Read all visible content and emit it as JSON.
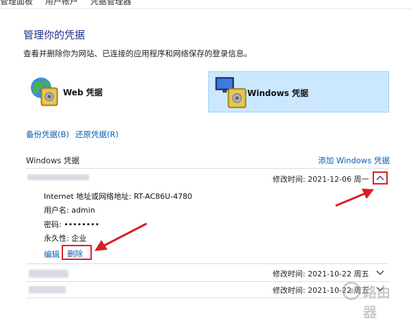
{
  "breadcrumb": {
    "items": [
      "管理面板",
      "用户帐户",
      "凭据管理器"
    ]
  },
  "page": {
    "title": "管理你的凭据",
    "subtitle": "查看并删除你为网站、已连接的应用程序和网络保存的登录信息。"
  },
  "tiles": {
    "web": {
      "label": "Web 凭据"
    },
    "windows": {
      "label": "Windows 凭据",
      "selected": true
    }
  },
  "actions": {
    "backup": "备份凭据(B)",
    "restore": "还原凭据(R)"
  },
  "section": {
    "title": "Windows 凭据",
    "add_link": "添加 Windows 凭据"
  },
  "credentials": [
    {
      "modified_label": "修改时间:",
      "modified_date": "2021-12-06 周一",
      "expanded": true,
      "details": {
        "address": "Internet 地址或网络地址: RT-AC86U-4780",
        "username": "用户名: admin",
        "password": "密码: ••••••••",
        "persistence": "永久性: 企业"
      },
      "edit_label": "编辑",
      "delete_label": "删除"
    },
    {
      "modified_label": "修改时间:",
      "modified_date": "2021-10-22 周五",
      "expanded": false
    },
    {
      "modified_label": "修改时间:",
      "modified_date": "2021-10-22 周五",
      "expanded": false
    }
  ],
  "icons": {
    "expanded": "chevron-up-icon",
    "collapsed": "chevron-down-icon"
  },
  "colors": {
    "link": "#0b5fb0",
    "title": "#1e3287",
    "annotation": "#d61f26",
    "selected_tile": "#cce8ff"
  },
  "watermark": "路由器"
}
